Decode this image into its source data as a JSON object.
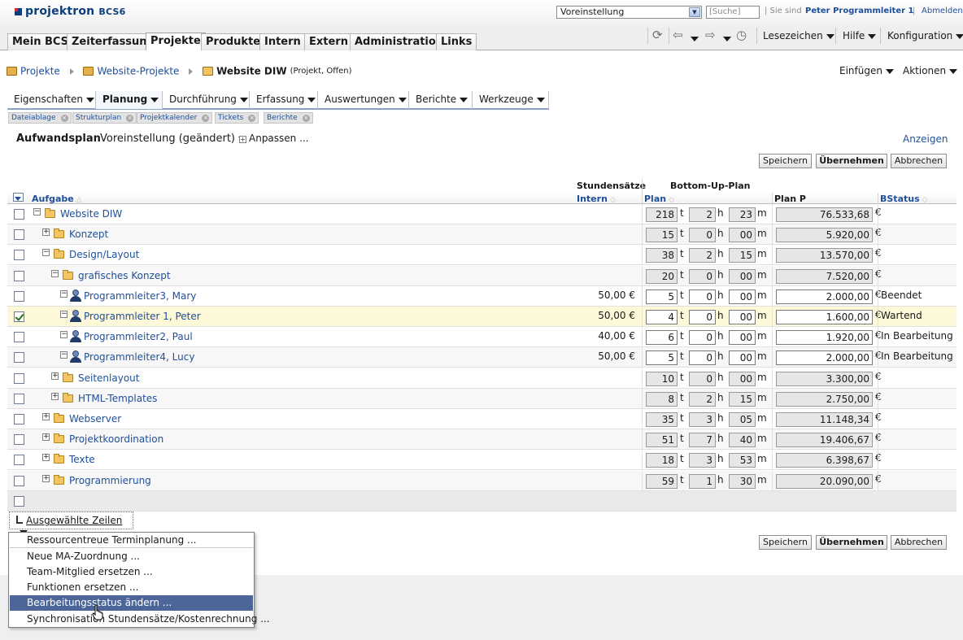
{
  "header": {
    "logo": "projektron",
    "logo_suffix": "BCS",
    "logo_version": "6",
    "profile_value": "Voreinstellung",
    "search_placeholder": "[Suche]",
    "logged_in_label": "| Sie sind",
    "user_name": "Peter Programmleiter 1",
    "separator": "|",
    "logout": "Abmelden"
  },
  "main_nav": {
    "tabs": [
      "Mein BCS",
      "Zeiterfassung",
      "Projekte",
      "Produkte",
      "Intern",
      "Extern",
      "Administration",
      "Links"
    ],
    "active": "Projekte",
    "menus": {
      "bookmarks": "Lesezeichen",
      "help": "Hilfe",
      "config": "Konfiguration"
    }
  },
  "breadcrumb": {
    "items": [
      "Projekte",
      "Website-Projekte"
    ],
    "current": "Website DIW",
    "current_sub": "(Projekt, Offen)"
  },
  "page_actions": {
    "insert": "Einfügen",
    "actions": "Aktionen"
  },
  "sub_nav": {
    "tabs": [
      "Eigenschaften",
      "Planung",
      "Durchführung",
      "Erfassung",
      "Auswertungen",
      "Berichte",
      "Werkzeuge"
    ],
    "active": "Planung"
  },
  "tool_tabs": [
    "Dateiablage",
    "Strukturplan",
    "Projektkalender",
    "Tickets",
    "Berichte"
  ],
  "plan": {
    "title": "Aufwandsplan",
    "variant": "Voreinstellung (geändert)",
    "customize": "Anpassen ...",
    "show": "Anzeigen"
  },
  "buttons": {
    "save": "Speichern",
    "apply": "Übernehmen",
    "cancel": "Abbrechen"
  },
  "table": {
    "group_rates": "Stundensätze",
    "group_bottomup": "Bottom-Up-Plan",
    "col_task": "Aufgabe",
    "col_intern": "Intern",
    "col_plan": "Plan",
    "col_planp": "Plan P",
    "col_bstatus": "BStatus",
    "unit_t": "t",
    "unit_h": "h",
    "unit_m": "m",
    "currency": "€",
    "rows": [
      {
        "name": "Website DIW",
        "level": 0,
        "type": "folder",
        "exp": "minus",
        "rate": "",
        "t": "218",
        "h": "2",
        "m": "23",
        "cost": "76.533,68",
        "status": "",
        "checked": false,
        "editable": false
      },
      {
        "name": "Konzept",
        "level": 1,
        "type": "folder",
        "exp": "plus",
        "rate": "",
        "t": "15",
        "h": "0",
        "m": "00",
        "cost": "5.920,00",
        "status": "",
        "checked": false,
        "editable": false
      },
      {
        "name": "Design/Layout",
        "level": 1,
        "type": "folder",
        "exp": "minus",
        "rate": "",
        "t": "38",
        "h": "2",
        "m": "15",
        "cost": "13.570,00",
        "status": "",
        "checked": false,
        "editable": false
      },
      {
        "name": "grafisches Konzept",
        "level": 2,
        "type": "folder",
        "exp": "minus",
        "rate": "",
        "t": "20",
        "h": "0",
        "m": "00",
        "cost": "7.520,00",
        "status": "",
        "checked": false,
        "editable": false
      },
      {
        "name": "Programmleiter3, Mary",
        "level": 3,
        "type": "person",
        "exp": "minus",
        "rate": "50,00 €",
        "t": "5",
        "h": "0",
        "m": "00",
        "cost": "2.000,00",
        "status": "Beendet",
        "checked": false,
        "editable": true
      },
      {
        "name": "Programmleiter 1, Peter",
        "level": 3,
        "type": "person",
        "exp": "minus",
        "rate": "50,00 €",
        "t": "4",
        "h": "0",
        "m": "00",
        "cost": "1.600,00",
        "status": "Wartend",
        "checked": true,
        "editable": true
      },
      {
        "name": "Programmleiter2, Paul",
        "level": 3,
        "type": "person",
        "exp": "minus",
        "rate": "40,00 €",
        "t": "6",
        "h": "0",
        "m": "00",
        "cost": "1.920,00",
        "status": "In Bearbeitung",
        "checked": false,
        "editable": true
      },
      {
        "name": "Programmleiter4, Lucy",
        "level": 3,
        "type": "person",
        "exp": "minus",
        "rate": "50,00 €",
        "t": "5",
        "h": "0",
        "m": "00",
        "cost": "2.000,00",
        "status": "In Bearbeitung",
        "checked": false,
        "editable": true
      },
      {
        "name": "Seitenlayout",
        "level": 2,
        "type": "folder",
        "exp": "plus",
        "rate": "",
        "t": "10",
        "h": "0",
        "m": "00",
        "cost": "3.300,00",
        "status": "",
        "checked": false,
        "editable": false
      },
      {
        "name": "HTML-Templates",
        "level": 2,
        "type": "folder",
        "exp": "plus",
        "rate": "",
        "t": "8",
        "h": "2",
        "m": "15",
        "cost": "2.750,00",
        "status": "",
        "checked": false,
        "editable": false
      },
      {
        "name": "Webserver",
        "level": 1,
        "type": "folder",
        "exp": "plus",
        "rate": "",
        "t": "35",
        "h": "3",
        "m": "05",
        "cost": "11.148,34",
        "status": "",
        "checked": false,
        "editable": false
      },
      {
        "name": "Projektkoordination",
        "level": 1,
        "type": "folder",
        "exp": "plus",
        "rate": "",
        "t": "51",
        "h": "7",
        "m": "40",
        "cost": "19.406,67",
        "status": "",
        "checked": false,
        "editable": false
      },
      {
        "name": "Texte",
        "level": 1,
        "type": "folder",
        "exp": "plus",
        "rate": "",
        "t": "18",
        "h": "3",
        "m": "53",
        "cost": "6.398,67",
        "status": "",
        "checked": false,
        "editable": false
      },
      {
        "name": "Programmierung",
        "level": 1,
        "type": "folder",
        "exp": "plus",
        "rate": "",
        "t": "59",
        "h": "1",
        "m": "30",
        "cost": "20.090,00",
        "status": "",
        "checked": false,
        "editable": false
      }
    ]
  },
  "selected_rows": {
    "label": "Ausgewählte Zeilen",
    "menu": [
      "Ressourcentreue Terminplanung ...",
      "Neue MA-Zuordnung ...",
      "Team-Mitglied ersetzen ...",
      "Funktionen ersetzen ...",
      "Bearbeitungsstatus ändern ...",
      "Synchronisation Stundensätze/Kostenrechnung ..."
    ],
    "highlighted": 4
  },
  "colors": {
    "link": "#1f4f9a",
    "menu_highlight": "#4c669a",
    "selected_row": "#fcf8d8",
    "folder": "#f2c462"
  }
}
